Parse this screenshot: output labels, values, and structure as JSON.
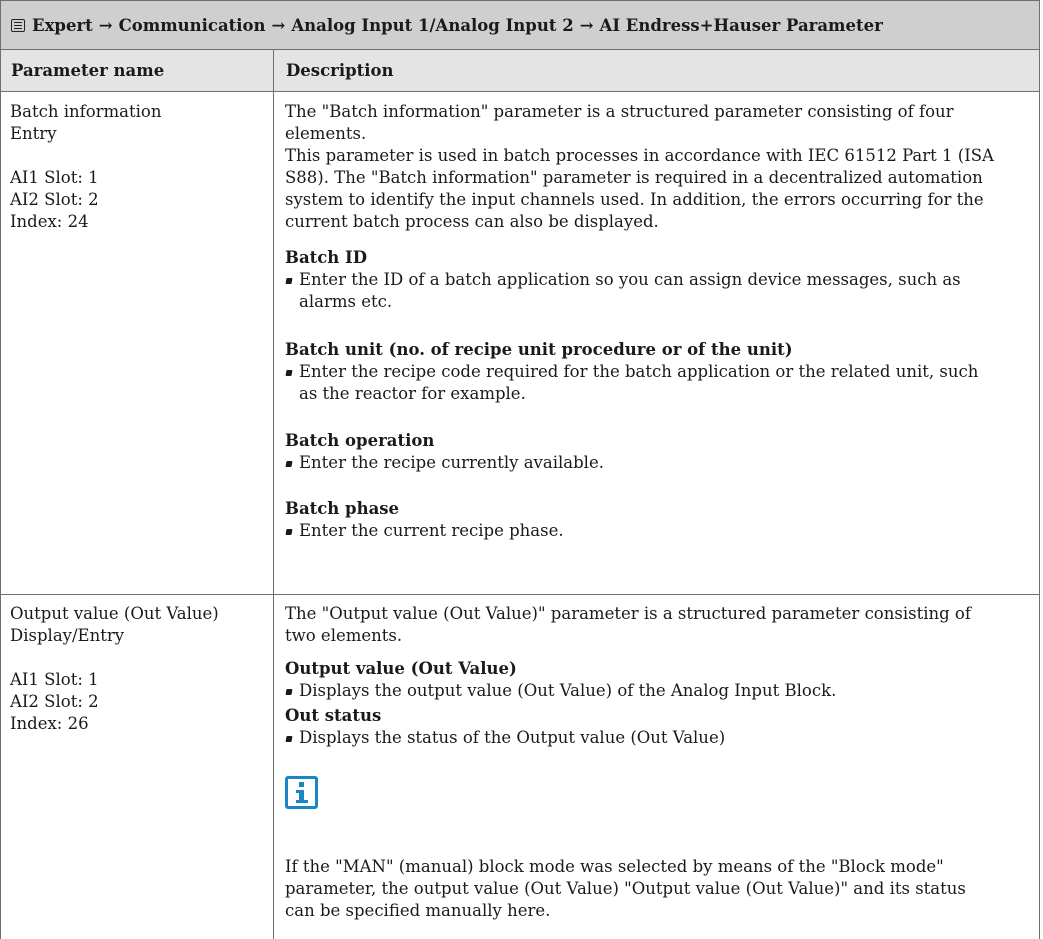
{
  "title": {
    "icon": "menu-screen-icon",
    "path": [
      "Expert",
      "Communication",
      "Analog Input 1/Analog Input 2",
      "AI Endress+Hauser Parameter"
    ],
    "separator": "→"
  },
  "table": {
    "headers": [
      "Parameter name",
      "Description"
    ],
    "rows": [
      {
        "left": [
          "Batch information",
          "Entry",
          "",
          "AI1 Slot: 1",
          "AI2 Slot: 2",
          "Index: 24"
        ],
        "intro": [
          "The \"Batch information\" parameter is a structured parameter consisting of four",
          "elements.",
          "This parameter is used in batch processes in accordance with IEC 61512 Part 1 (ISA",
          "S88). The \"Batch information\" parameter is required in a decentralized automation",
          "system to identify the input channels used. In addition, the errors occurring for the",
          "current batch process can also be displayed."
        ],
        "items": [
          {
            "heading": "Batch ID",
            "bullet": [
              "Enter the ID of a batch application so you can assign device messages, such as",
              "alarms etc."
            ]
          },
          {
            "heading": "Batch unit (no. of recipe unit procedure or of the unit)",
            "bullet": [
              "Enter the recipe code required for the batch application or the related unit, such",
              "as the reactor for example."
            ]
          },
          {
            "heading": "Batch operation",
            "bullet": [
              "Enter the recipe currently available."
            ]
          },
          {
            "heading": "Batch phase",
            "bullet": [
              "Enter the current recipe phase."
            ]
          }
        ]
      },
      {
        "left": [
          "Output value (Out Value)",
          "Display/Entry",
          "",
          "AI1 Slot: 1",
          "AI2 Slot: 2",
          "Index: 26"
        ],
        "intro": [
          "The \"Output value (Out Value)\" parameter is a structured parameter consisting of",
          "two elements."
        ],
        "items": [
          {
            "heading": "Output value (Out Value)",
            "bullet": [
              "Displays the output value (Out Value) of the Analog Input Block."
            ]
          },
          {
            "heading": "Out status",
            "bullet": [
              "Displays the status of the Output value (Out Value)"
            ]
          }
        ],
        "note_icon": "info-icon",
        "note": [
          "If the \"MAN\" (manual) block mode was selected by means of the \"Block mode\"",
          "parameter, the output value (Out Value) \"Output value (Out Value)\" and its status",
          "can be specified manually here."
        ]
      }
    ]
  }
}
